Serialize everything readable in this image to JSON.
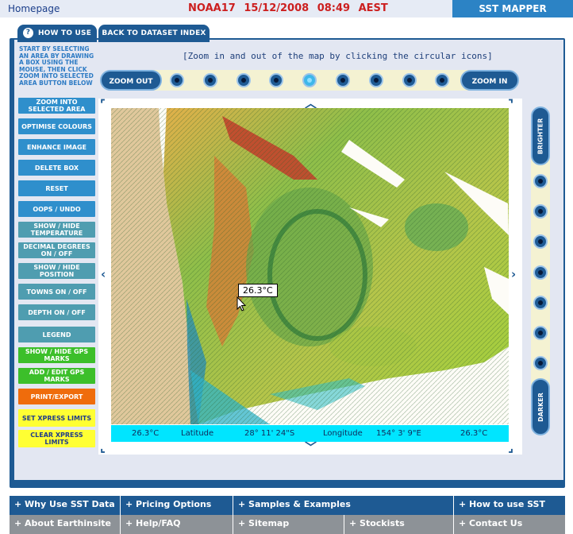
{
  "header": {
    "home_link": "Homepage",
    "status": "NOAA17 15/12/2008 08:49 AEST",
    "brand": "SST MAPPER",
    "colors": {
      "status_text": "#cc1f1f",
      "brand_bg": "#2c83c5"
    }
  },
  "tabs": {
    "how_to_use": "HOW TO USE",
    "back": "BACK TO DATASET INDEX"
  },
  "instructions": "START BY SELECTING AN AREA BY DRAWING A BOX USING THE MOUSE, THEN CLICK ZOOM INTO SELECTED AREA BUTTON BELOW",
  "zoom": {
    "hint": "[Zoom in and out of the map by clicking the circular icons]",
    "out_label": "ZOOM OUT",
    "in_label": "ZOOM IN",
    "level_count": 9,
    "active_level": 5
  },
  "left_buttons": [
    {
      "label": "ZOOM INTO SELECTED AREA",
      "color": "blue"
    },
    {
      "label": "OPTIMISE COLOURS",
      "color": "blue"
    },
    {
      "label": "ENHANCE IMAGE",
      "color": "blue"
    },
    {
      "label": "DELETE BOX",
      "color": "blue"
    },
    {
      "label": "RESET",
      "color": "blue"
    },
    {
      "label": "OOPS / UNDO",
      "color": "blue"
    },
    {
      "label": "SHOW / HIDE TEMPERATURE",
      "color": "teal"
    },
    {
      "label": "DECIMAL DEGREES ON / OFF",
      "color": "teal"
    },
    {
      "label": "SHOW / HIDE POSITION",
      "color": "teal"
    },
    {
      "label": "TOWNS ON / OFF",
      "color": "teal"
    },
    {
      "label": "DEPTH ON / OFF",
      "color": "teal"
    },
    {
      "label": "LEGEND",
      "color": "teal"
    },
    {
      "label": "SHOW / HIDE GPS MARKS",
      "color": "green"
    },
    {
      "label": "ADD / EDIT GPS MARKS",
      "color": "green"
    },
    {
      "label": "PRINT/EXPORT",
      "color": "orange"
    },
    {
      "label": "SET XPRESS LIMITS",
      "color": "yellow"
    },
    {
      "label": "CLEAR XPRESS LIMITS",
      "color": "yellow"
    }
  ],
  "map": {
    "tooltip": "26.3°C",
    "readout": {
      "temp_left": "26.3°C",
      "lat_label": "Latitude",
      "lat_value": "28° 11' 24\"S",
      "lon_label": "Longitude",
      "lon_value": "154° 3' 9\"E",
      "temp_right": "26.3°C"
    }
  },
  "contrast": {
    "brighter": "BRIGHTER",
    "darker": "DARKER",
    "level_count": 9
  },
  "footer": {
    "row1": [
      "Why Use SST Data",
      "Pricing Options",
      "Samples & Examples",
      "How to use SST"
    ],
    "row2": [
      "About Earthinsite",
      "Help/FAQ",
      "Sitemap",
      "Stockists",
      "Contact Us"
    ]
  }
}
